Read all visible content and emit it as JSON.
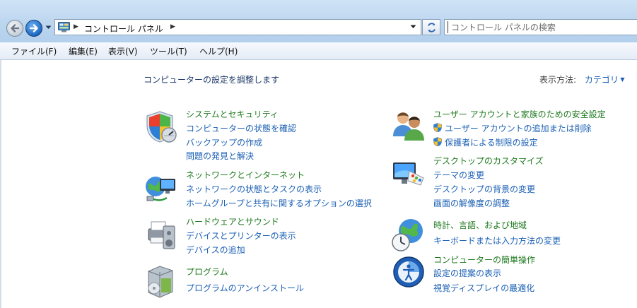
{
  "address_bar": {
    "path": "コントロール パネル"
  },
  "search": {
    "placeholder": "コントロール パネルの検索"
  },
  "menu": [
    "ファイル(F)",
    "編集(E)",
    "表示(V)",
    "ツール(T)",
    "ヘルプ(H)"
  ],
  "heading": "コンピューターの設定を調整します",
  "view_mode": {
    "label": "表示方法:",
    "value": "カテゴリ"
  },
  "categories": [
    {
      "icon": "shield-windows-icon",
      "title": "システムとセキュリティ",
      "links": [
        "コンピューターの状態を確認",
        "バックアップの作成",
        "問題の発見と解決"
      ]
    },
    {
      "icon": "network-globe-icon",
      "title": "ネットワークとインターネット",
      "links": [
        "ネットワークの状態とタスクの表示",
        "ホームグループと共有に関するオプションの選択"
      ]
    },
    {
      "icon": "printer-icon",
      "title": "ハードウェアとサウンド",
      "links": [
        "デバイスとプリンターの表示",
        "デバイスの追加"
      ]
    },
    {
      "icon": "programs-box-icon",
      "title": "プログラム",
      "links": [
        "プログラムのアンインストール"
      ]
    },
    {
      "icon": "users-icon",
      "title": "ユーザー アカウントと家族のための安全設定",
      "links": [
        "ユーザー アカウントの追加または削除",
        "保護者による制限の設定"
      ]
    },
    {
      "icon": "display-palette-icon",
      "title": "デスクトップのカスタマイズ",
      "links": [
        "テーマの変更",
        "デスクトップの背景の変更",
        "画面の解像度の調整"
      ]
    },
    {
      "icon": "clock-globe-icon",
      "title": "時計、言語、および地域",
      "links": [
        "キーボードまたは入力方法の変更"
      ]
    },
    {
      "icon": "ease-of-access-icon",
      "title": "コンピューターの簡単操作",
      "links": [
        "設定の提案の表示",
        "視覚ディスプレイの最適化"
      ]
    }
  ],
  "colors": {
    "link": "#1a5fb4",
    "category_title": "#1f7a1f",
    "heading": "#1e3a6a"
  }
}
